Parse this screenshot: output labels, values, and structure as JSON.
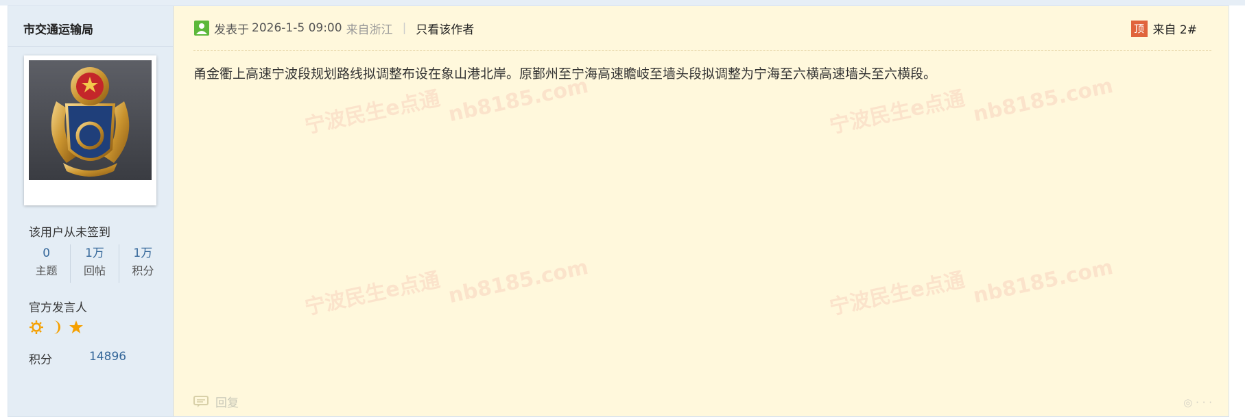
{
  "author": {
    "name": "市交通运输局",
    "signin_text": "该用户从未签到",
    "stats": [
      {
        "value": "0",
        "label": "主题"
      },
      {
        "value": "1万",
        "label": "回帖"
      },
      {
        "value": "1万",
        "label": "积分"
      }
    ],
    "role": "官方发言人",
    "medals": [
      "sun-medal-icon",
      "moon-medal-icon",
      "star-medal-icon"
    ],
    "score_label": "积分",
    "score_value": "14896"
  },
  "post": {
    "posted_label": "发表于",
    "posted_time": "2026-1-5 09:00",
    "from_location": "来自浙江",
    "separator": "|",
    "only_author_label": "只看该作者",
    "top_badge": "顶",
    "floor_label": "来自 2#",
    "content": "甬金衢上高速宁波段规划路线拟调整布设在象山港北岸。原鄞州至宁海高速瞻岐至墙头段拟调整为宁海至六横高速墙头至六横段。",
    "reply_label": "回复"
  },
  "watermark": {
    "brand_text": "宁波民生e点通",
    "domain_text": "nb8185.com"
  },
  "colors": {
    "post_bg": "#fff8dc",
    "sidebar_bg": "#e4edf5",
    "link_blue": "#336699",
    "medal_orange": "#f5a000",
    "badge_red": "#e0643c"
  }
}
